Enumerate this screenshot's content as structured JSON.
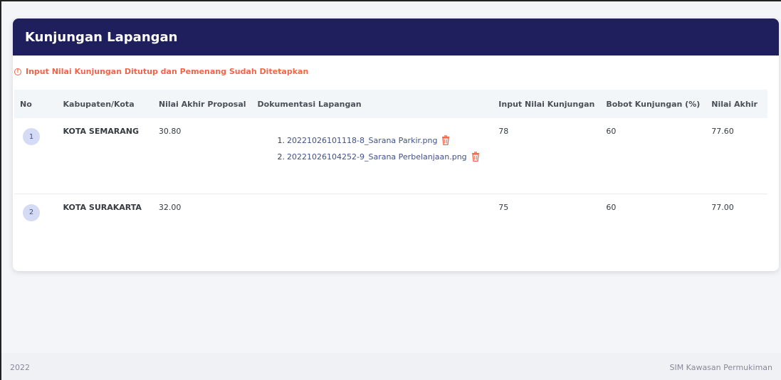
{
  "card": {
    "title": "Kunjungan Lapangan"
  },
  "alert": {
    "text": "Input Nilai Kunjungan Ditutup dan Pemenang Sudah Ditetapkan",
    "color": "#f06548"
  },
  "table": {
    "headers": [
      "No",
      "Kabupaten/Kota",
      "Nilai Akhir Proposal",
      "Dokumentasi Lapangan",
      "Input Nilai Kunjungan",
      "Bobot Kunjungan (%)",
      "Nilai Akhir"
    ],
    "rows": [
      {
        "no": "1",
        "kabupaten": "KOTA SEMARANG",
        "nilai_proposal": "30.80",
        "docs": [
          {
            "num": "1.",
            "name": "20221026101118-8_Sarana Parkir.png"
          },
          {
            "num": "2.",
            "name": "20221026104252-9_Sarana Perbelanjaan.png"
          }
        ],
        "input_nilai": "78",
        "bobot": "60",
        "nilai_akhir": "77.60"
      },
      {
        "no": "2",
        "kabupaten": "KOTA SURAKARTA",
        "nilai_proposal": "32.00",
        "docs": [],
        "input_nilai": "75",
        "bobot": "60",
        "nilai_akhir": "77.00"
      }
    ]
  },
  "footer": {
    "year": "2022",
    "app_name": "SIM Kawasan Permukiman"
  },
  "colors": {
    "header_bg": "#1f1f5e",
    "link": "#405189",
    "danger": "#f06548"
  },
  "icons": {
    "alert": "info-circle-icon",
    "delete": "trash-icon"
  }
}
